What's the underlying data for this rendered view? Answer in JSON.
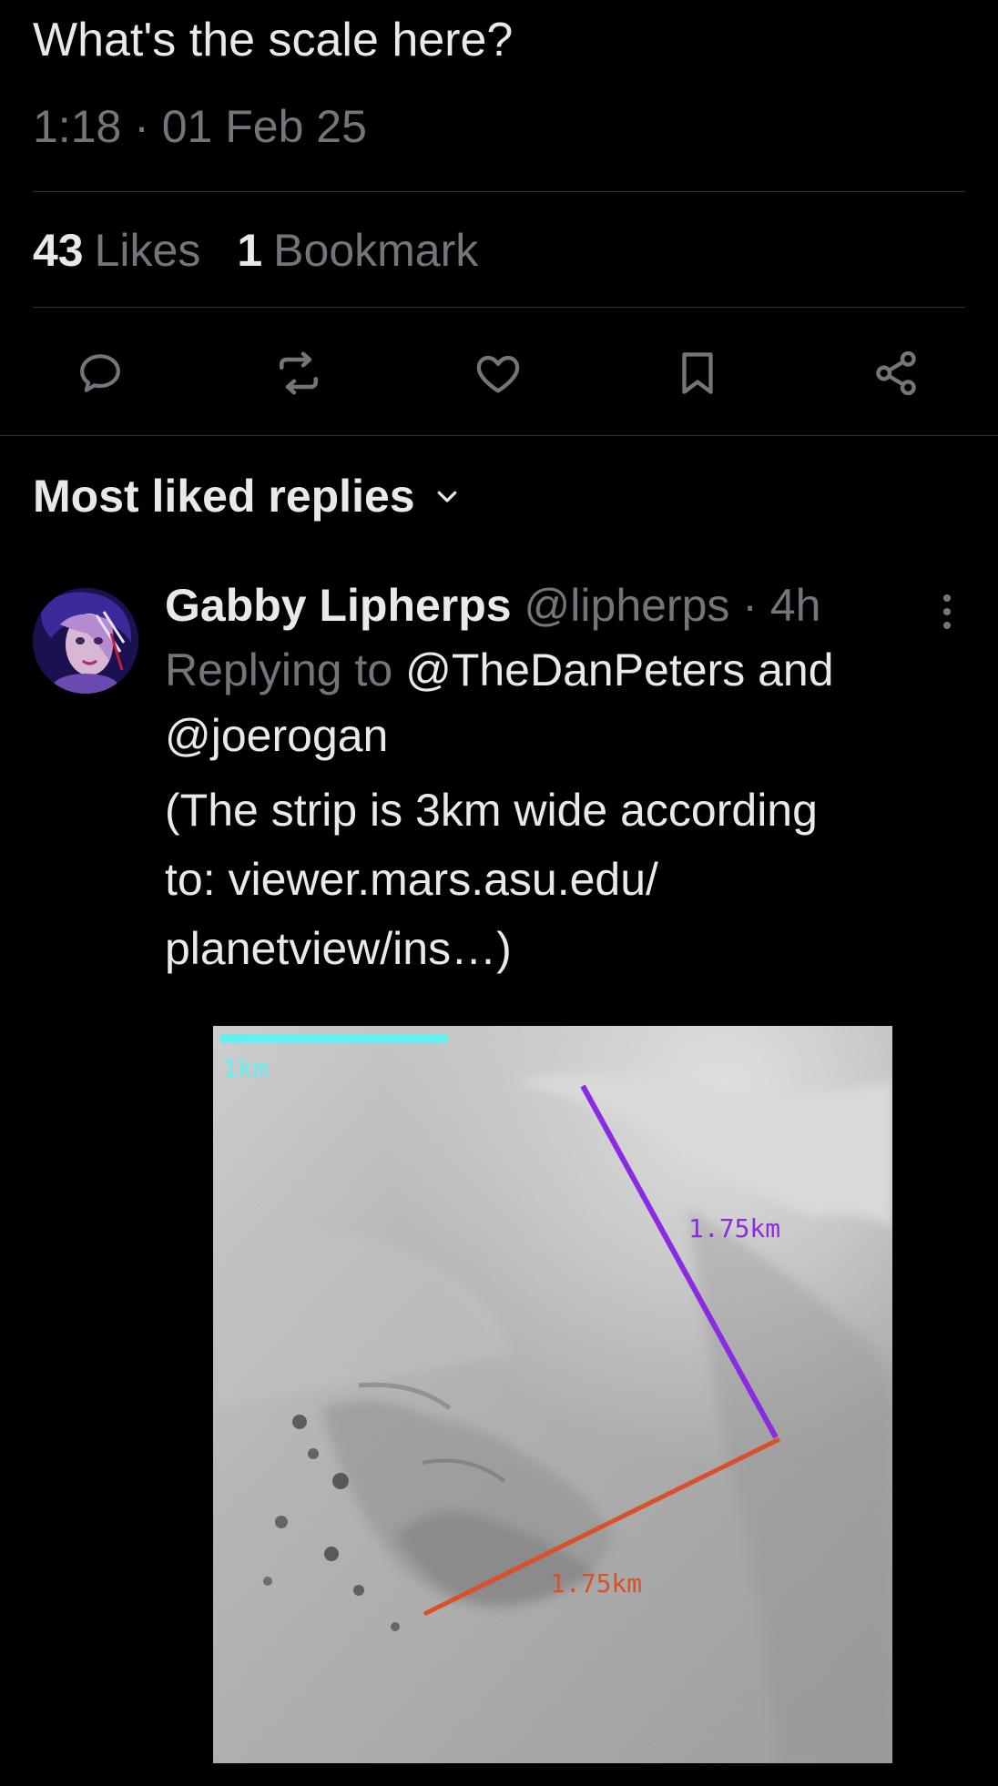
{
  "tweet": {
    "text": "What's the scale here?",
    "timestamp": "1:18 · 01 Feb 25",
    "likes_count": "43",
    "likes_label": "Likes",
    "bookmarks_count": "1",
    "bookmarks_label": "Bookmark"
  },
  "actions": [
    {
      "name": "reply",
      "icon": "reply-icon"
    },
    {
      "name": "repost",
      "icon": "repost-icon"
    },
    {
      "name": "like",
      "icon": "heart-icon"
    },
    {
      "name": "bookmark",
      "icon": "bookmark-icon"
    },
    {
      "name": "share",
      "icon": "share-icon"
    }
  ],
  "replies_section": {
    "title": "Most liked replies",
    "dropdown_icon": "chevron-down-icon"
  },
  "reply": {
    "author_name": "Gabby Lipherps",
    "author_handle": "@lipherps",
    "separator": "·",
    "time": "4h",
    "replying_prefix": "Replying to",
    "replying_user1": "@TheDanPeters",
    "replying_and": "and",
    "replying_user2": "@joerogan",
    "body_lines": [
      "(The strip is 3km wide according",
      "to: viewer.mars.asu.edu/",
      "planetview/ins…)"
    ],
    "media": {
      "scale_label": "1km",
      "measure_purple": "1.75km",
      "measure_orange": "1.75km",
      "colors": {
        "scale_bar": "#5ff2f2",
        "purple_line": "#8a2be2",
        "orange_line": "#d9502a"
      }
    }
  },
  "colors": {
    "background": "#000000",
    "text_primary": "#e7e9ea",
    "text_secondary": "#71767b",
    "divider": "#2f3336"
  }
}
